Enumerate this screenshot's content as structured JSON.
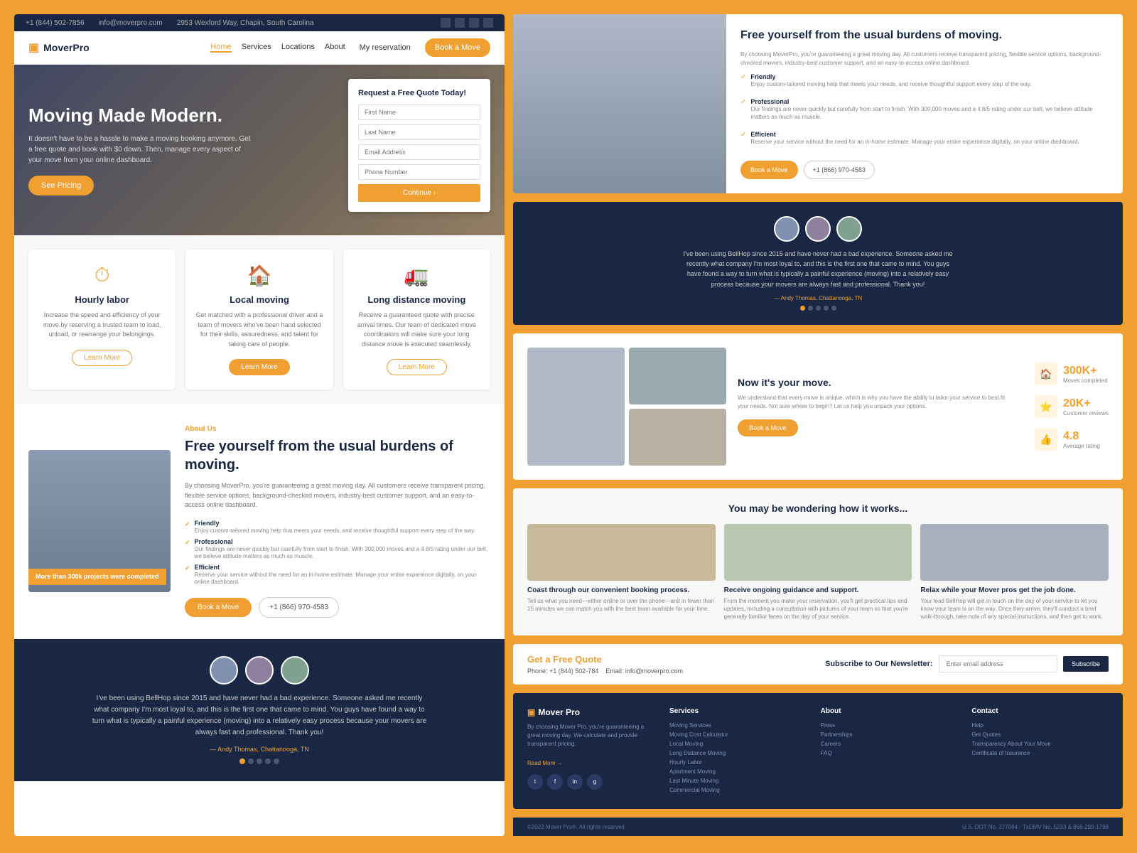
{
  "brand": {
    "name": "MoverPro",
    "tagline": "Mover Pro"
  },
  "topbar": {
    "phone": "+1 (844) 502-7856",
    "email": "info@moverpro.com",
    "address": "2953 Wexford Way, Chapin, South Carolina"
  },
  "nav": {
    "links": [
      "Home",
      "Services",
      "Locations",
      "About"
    ],
    "reservation": "My reservation",
    "book_btn": "Book a Move"
  },
  "hero": {
    "title": "Moving Made Modern.",
    "description": "It doesn't have to be a hassle to make a moving booking anymore. Get a free quote and book with $0 down. Then, manage every aspect of your move from your online dashboard.",
    "cta": "See Pricing",
    "form_title": "Request a Free Quote Today!",
    "form_fields": [
      "First Name",
      "Last Name",
      "Email Address",
      "Phone Number"
    ],
    "form_btn": "Continue"
  },
  "services": [
    {
      "icon": "⏱",
      "title": "Hourly labor",
      "description": "Increase the speed and efficiency of your move by reserving a trusted team to load, unload, or rearrange your belongings.",
      "btn": "Learn More"
    },
    {
      "icon": "🏠",
      "title": "Local moving",
      "description": "Get matched with a professional driver and a team of movers who've been hand selected for their skills, assuredness, and talent for taking care of people.",
      "btn": "Learn More",
      "featured": true
    },
    {
      "icon": "🚛",
      "title": "Long distance moving",
      "description": "Receive a guaranteed quote with precise arrival times. Our team of dedicated move coordinators will make sure your long distance move is executed seamlessly.",
      "btn": "Learn More"
    }
  ],
  "about": {
    "tag": "About Us",
    "title": "Free yourself from the usual burdens of moving.",
    "description": "By choosing MoverPro, you're guaranteeing a great moving day. All customers receive transparent pricing, flexible service options, background-checked movers, industry-best customer support, and an easy-to-access online dashboard.",
    "badge": "More than 300k projects were completed",
    "features": [
      {
        "name": "Friendly",
        "desc": "Enjoy custom-tailored moving help that meets your needs, and receive thoughtful support every step of the way."
      },
      {
        "name": "Professional",
        "desc": "Our findings are never quickly but carefully from start to finish. With 300,000 moves and a 4.8/5 rating under our belt, we believe attitude matters as much as muscle."
      },
      {
        "name": "Efficient",
        "desc": "Reserve your service without the need for an in-home estimate. Manage your entire experience digitally, on your online dashboard."
      }
    ],
    "book_btn": "Book a Move",
    "phone": "+1 (866) 970-4583"
  },
  "testimonials": {
    "quote": "I've been using BellHop since 2015 and have never had a bad experience. Someone asked me recently what company I'm most loyal to, and this is the first one that came to mind. You guys have found a way to turn what is typically a painful experience (moving) into a relatively easy process because your movers are always fast and professional. Thank you!",
    "author": "— Andy Thomas, Chattanooga, TN",
    "dots": [
      true,
      false,
      false,
      false,
      false
    ]
  },
  "your_move": {
    "title": "Now it's your move.",
    "description": "We understand that every move is unique, which is why you have the ability to tailor your service to best fit your needs. Not sure where to begin? Let us help you unpack your options.",
    "book_btn": "Book a Move",
    "stats": [
      {
        "num": "300K+",
        "label": "Moves completed"
      },
      {
        "num": "20K+",
        "label": "Customer reviews"
      },
      {
        "num": "4.8",
        "label": "Average rating"
      }
    ]
  },
  "how_it_works": {
    "title": "You may be wondering how it works...",
    "steps": [
      {
        "title": "Coast through our convenient booking process.",
        "desc": "Tell us what you need—either online or over the phone—and in fewer than 15 minutes we can match you with the best team available for your time."
      },
      {
        "title": "Receive ongoing guidance and support.",
        "desc": "From the moment you make your reservation, you'll get practical tips and updates, including a consultation with pictures of your team so that you're generally familiar faces on the day of your service."
      },
      {
        "title": "Relax while your Mover pros get the job done.",
        "desc": "Your lead BellHop will get in touch on the day of your service to let you know your team is on the way. Once they arrive, they'll conduct a brief walk-through, take note of any special instructions, and then get to work."
      }
    ]
  },
  "footer_cta": {
    "quote_title": "Get a Free Quote",
    "phone": "Phone: +1 (844) 502-784",
    "email": "Email: info@moverpro.com",
    "newsletter_title": "Subscribe to Our Newsletter:",
    "newsletter_placeholder": "Enter email address",
    "newsletter_btn": "Subscribe"
  },
  "footer": {
    "description": "By choosing Mover Pro, you're guaranteeing a great moving day. We calculate and provide transparent pricing.",
    "read_more": "Read More →",
    "socials": [
      "t",
      "f",
      "in",
      "g"
    ],
    "cols": [
      {
        "title": "Services",
        "items": [
          "Moving Services",
          "Moving Cost Calculator",
          "Local Moving",
          "Long Distance Moving",
          "Hourly Labor",
          "Apartment Moving",
          "Last Minute Moving",
          "Commercial Moving"
        ]
      },
      {
        "title": "About",
        "items": [
          "Press",
          "Partnerships",
          "Careers",
          "FAQ"
        ]
      },
      {
        "title": "Contact",
        "items": [
          "Help",
          "Get Quotes",
          "Transparency About Your Move",
          "Certificate of Insurance"
        ]
      }
    ],
    "copyright": "©2022 Mover Pro®. All rights reserved",
    "license": "U.S. DOT No. 277084 · TxDMV No. 5233 & 866-299-1798"
  }
}
